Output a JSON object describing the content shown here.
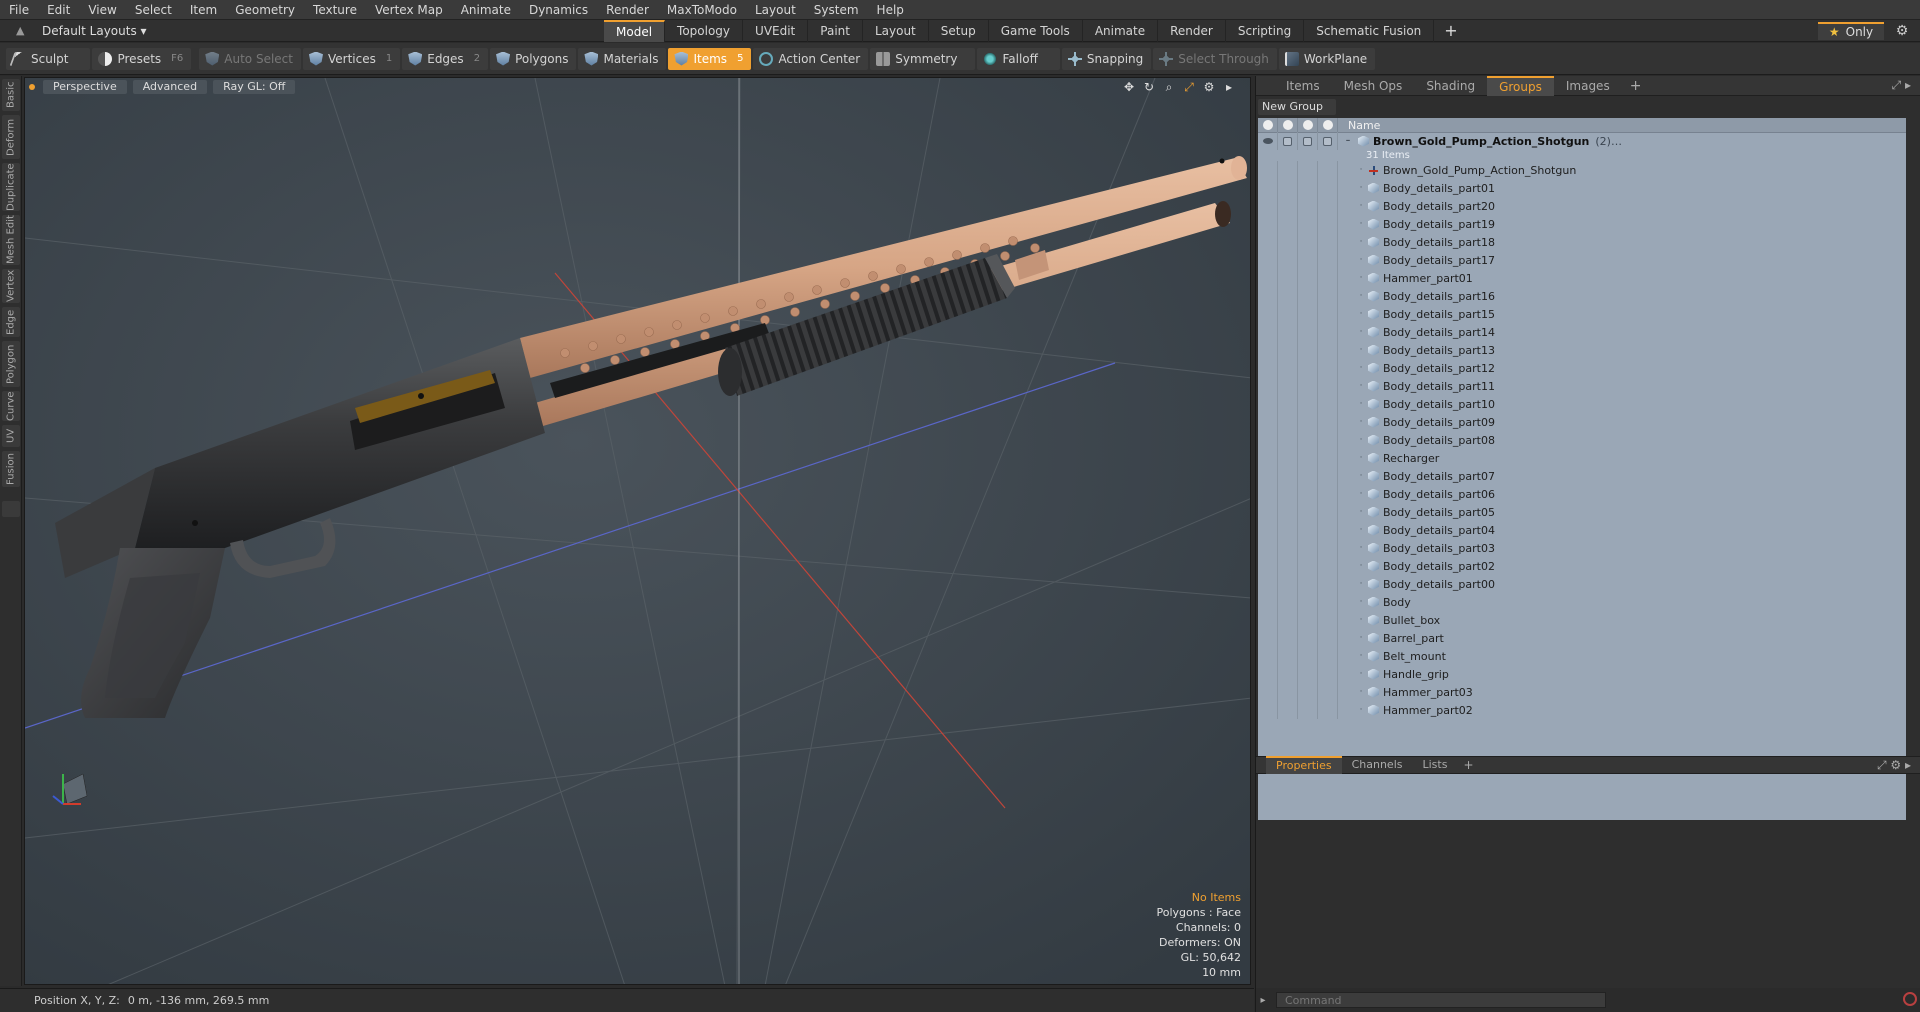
{
  "menu": [
    "File",
    "Edit",
    "View",
    "Select",
    "Item",
    "Geometry",
    "Texture",
    "Vertex Map",
    "Animate",
    "Dynamics",
    "Render",
    "MaxToModo",
    "Layout",
    "System",
    "Help"
  ],
  "layout": {
    "dropdown": "Default Layouts ▾",
    "only_label": "Only"
  },
  "tabs": [
    "Model",
    "Topology",
    "UVEdit",
    "Paint",
    "Layout",
    "Setup",
    "Game Tools",
    "Animate",
    "Render",
    "Scripting",
    "Schematic Fusion"
  ],
  "active_tab": "Model",
  "toolbar": {
    "sculpt": "Sculpt",
    "presets": "Presets",
    "presets_key": "F6",
    "auto_select": "Auto Select",
    "vertices": "Vertices",
    "vertices_key": "1",
    "edges": "Edges",
    "edges_key": "2",
    "polygons": "Polygons",
    "materials": "Materials",
    "items": "Items",
    "items_key": "5",
    "action_center": "Action Center",
    "symmetry": "Symmetry",
    "falloff": "Falloff",
    "snapping": "Snapping",
    "select_through": "Select Through",
    "workplane": "WorkPlane"
  },
  "left_tabs": [
    "Basic",
    "Deform",
    "Duplicate",
    "Mesh Edit",
    "Vertex",
    "Edge",
    "Polygon",
    "Curve",
    "UV",
    "Fusion"
  ],
  "viewport": {
    "view": "Perspective",
    "shading": "Advanced",
    "raygl": "Ray GL: Off",
    "info": {
      "selection": "No Items",
      "polygons": "Polygons : Face",
      "channels": "Channels: 0",
      "deformers": "Deformers: ON",
      "gl": "GL: 50,642",
      "scale": "10 mm"
    }
  },
  "status": {
    "label": "Position X, Y, Z:",
    "value": "0 m, -136 mm, 269.5 mm"
  },
  "right_panel": {
    "tabs": [
      "Items",
      "Mesh Ops",
      "Shading",
      "Groups",
      "Images"
    ],
    "active_tab": "Groups",
    "new_group": "New Group",
    "name_header": "Name",
    "group": {
      "name": "Brown_Gold_Pump_Action_Shotgun",
      "count": "(2)…",
      "sub": "31 Items"
    },
    "items": [
      {
        "name": "Brown_Gold_Pump_Action_Shotgun",
        "type": "locator"
      },
      {
        "name": "Body_details_part01",
        "type": "mesh"
      },
      {
        "name": "Body_details_part20",
        "type": "mesh"
      },
      {
        "name": "Body_details_part19",
        "type": "mesh"
      },
      {
        "name": "Body_details_part18",
        "type": "mesh"
      },
      {
        "name": "Body_details_part17",
        "type": "mesh"
      },
      {
        "name": "Hammer_part01",
        "type": "mesh"
      },
      {
        "name": "Body_details_part16",
        "type": "mesh"
      },
      {
        "name": "Body_details_part15",
        "type": "mesh"
      },
      {
        "name": "Body_details_part14",
        "type": "mesh"
      },
      {
        "name": "Body_details_part13",
        "type": "mesh"
      },
      {
        "name": "Body_details_part12",
        "type": "mesh"
      },
      {
        "name": "Body_details_part11",
        "type": "mesh"
      },
      {
        "name": "Body_details_part10",
        "type": "mesh"
      },
      {
        "name": "Body_details_part09",
        "type": "mesh"
      },
      {
        "name": "Body_details_part08",
        "type": "mesh"
      },
      {
        "name": "Recharger",
        "type": "mesh"
      },
      {
        "name": "Body_details_part07",
        "type": "mesh"
      },
      {
        "name": "Body_details_part06",
        "type": "mesh"
      },
      {
        "name": "Body_details_part05",
        "type": "mesh"
      },
      {
        "name": "Body_details_part04",
        "type": "mesh"
      },
      {
        "name": "Body_details_part03",
        "type": "mesh"
      },
      {
        "name": "Body_details_part02",
        "type": "mesh"
      },
      {
        "name": "Body_details_part00",
        "type": "mesh"
      },
      {
        "name": "Body",
        "type": "mesh"
      },
      {
        "name": "Bullet_box",
        "type": "mesh"
      },
      {
        "name": "Barrel_part",
        "type": "mesh"
      },
      {
        "name": "Belt_mount",
        "type": "mesh"
      },
      {
        "name": "Handle_grip",
        "type": "mesh"
      },
      {
        "name": "Hammer_part03",
        "type": "mesh"
      },
      {
        "name": "Hammer_part02",
        "type": "mesh"
      }
    ],
    "bottom_tabs": [
      "Properties",
      "Channels",
      "Lists"
    ],
    "bottom_active": "Properties",
    "command_placeholder": "Command"
  },
  "colors": {
    "accent": "#f0a030",
    "viewport_bg": "#3d464d",
    "barrel": "#d8a88a",
    "receiver": "#2f3032",
    "list_bg": "#9aa7b6"
  }
}
